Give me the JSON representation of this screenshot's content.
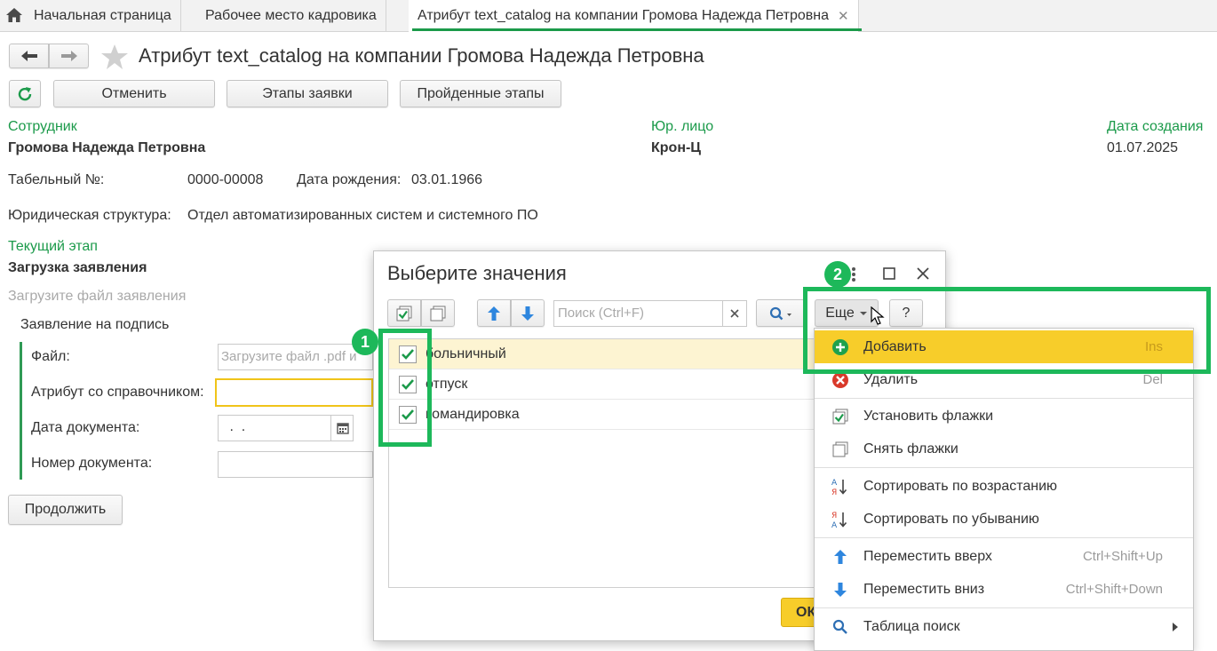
{
  "tabs": [
    {
      "label": "Начальная страница"
    },
    {
      "label": "Рабочее место кадровика"
    },
    {
      "label": "Атрибут text_catalog на компании Громова Надежда Петровна"
    }
  ],
  "page": {
    "title": "Атрибут text_catalog на компании Громова Надежда Петровна",
    "toolbar": {
      "cancel": "Отменить",
      "stages": "Этапы заявки",
      "passed": "Пройденные этапы"
    }
  },
  "form": {
    "employee_label": "Сотрудник",
    "employee_value": "Громова Надежда Петровна",
    "entity_label": "Юр. лицо",
    "entity_value": "Крон-Ц",
    "created_label": "Дата создания",
    "created_value": "01.07.2025",
    "tab_no_label": "Табельный №:",
    "tab_no_value": "0000-00008",
    "birth_label": "Дата рождения:",
    "birth_value": "03.01.1966",
    "structure_label": "Юридическая структура:",
    "structure_value": "Отдел автоматизированных систем и системного ПО",
    "stage_label": "Текущий этап",
    "stage_value": "Загрузка заявления",
    "upload_hint": "Загрузите файл заявления",
    "group_title": "Заявление на подпись",
    "file_label": "Файл:",
    "file_placeholder": "Загрузите файл .pdf и",
    "attr_label": "Атрибут со справочником:",
    "date_label": "Дата документа:",
    "date_value": " .  .",
    "num_label": "Номер документа:",
    "continue": "Продолжить"
  },
  "dialog": {
    "title": "Выберите значения",
    "search_placeholder": "Поиск (Ctrl+F)",
    "more": "Еще",
    "help": "?",
    "items": [
      {
        "label": "больничный",
        "checked": true
      },
      {
        "label": "отпуск",
        "checked": true
      },
      {
        "label": "командировка",
        "checked": true
      }
    ],
    "ok": "ОК"
  },
  "menu": {
    "add": {
      "label": "Добавить",
      "shortcut": "Ins"
    },
    "delete": {
      "label": "Удалить",
      "shortcut": "Del"
    },
    "set_flags": {
      "label": "Установить флажки"
    },
    "clear_flags": {
      "label": "Снять флажки"
    },
    "sort_asc": {
      "label": "Сортировать по возрастанию"
    },
    "sort_desc": {
      "label": "Сортировать по убыванию"
    },
    "move_up": {
      "label": "Переместить вверх",
      "shortcut": "Ctrl+Shift+Up"
    },
    "move_down": {
      "label": "Переместить вниз",
      "shortcut": "Ctrl+Shift+Down"
    },
    "search_table": {
      "label": "Таблица поиск"
    }
  },
  "annotations": {
    "badge1": "1",
    "badge2": "2"
  },
  "colors": {
    "accent_green": "#1b9a4a",
    "highlight_green": "#1db85a",
    "menu_highlight": "#f7cd2a",
    "selected_row": "#fdf4d2"
  }
}
